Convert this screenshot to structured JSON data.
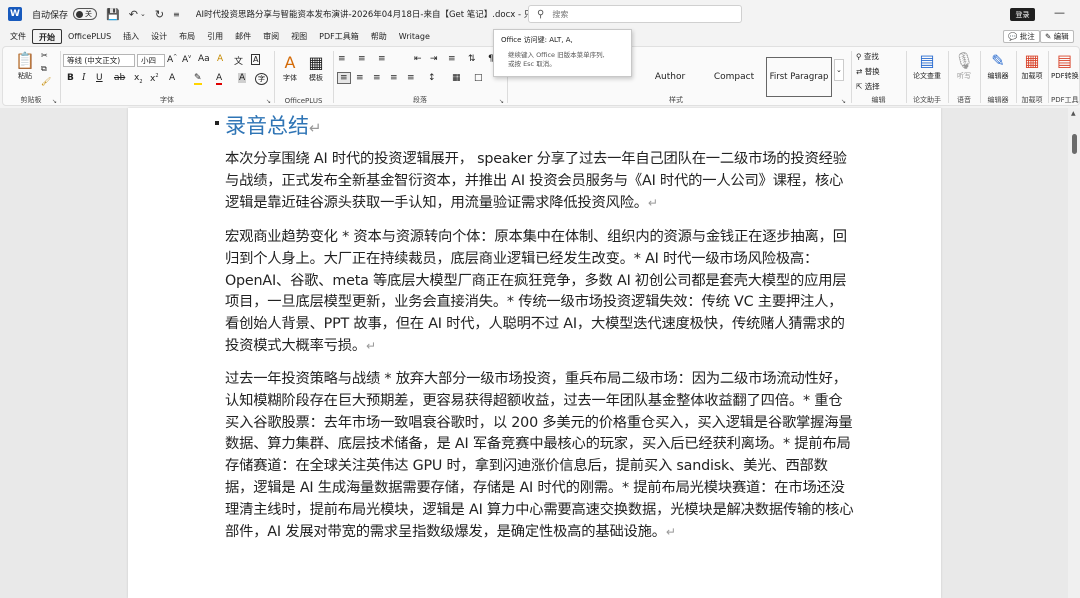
{
  "titlebar": {
    "app_icon": "W",
    "autosave_label": "自动保存",
    "autosave_state": "关",
    "doc_title": "AI时代投资思路分享与智能资本发布演讲-2026年04月18日-来自【Get 笔记】.docx - 只读 - 兼容性...",
    "search_placeholder": "搜索",
    "login_label": "登录",
    "minimize_glyph": "—"
  },
  "tabs": [
    "文件",
    "开始",
    "OfficePLUS",
    "插入",
    "设计",
    "布局",
    "引用",
    "邮件",
    "审阅",
    "视图",
    "PDF工具箱",
    "帮助",
    "Writage"
  ],
  "active_tab": "开始",
  "header_buttons": {
    "comment": "批注",
    "edit": "编辑"
  },
  "tooltip": {
    "title": "Office 访问键: ALT, A,",
    "line1": "继续键入 Office 旧版本菜单序列,",
    "line2": "或按 Esc 取消。"
  },
  "ribbon": {
    "clipboard": {
      "paste": "粘贴",
      "label": "剪贴板"
    },
    "font": {
      "font_name": "等线 (中文正文)",
      "font_size": "小四",
      "label": "字体"
    },
    "officeplus": {
      "btn1": "字体",
      "btn2": "模板",
      "label": "OfficePLUS"
    },
    "paragraph": {
      "label": "段落"
    },
    "styles": {
      "items": [
        "Author",
        "Compact",
        "First Paragrap"
      ],
      "label": "样式"
    },
    "editing": {
      "find": "查找",
      "replace": "替换",
      "select": "选择",
      "label": "编辑"
    },
    "assistant": {
      "btn": "论文查重",
      "label": "论文助手"
    },
    "voice": {
      "btn": "听写",
      "label": "语音"
    },
    "editor": {
      "btn": "编辑器",
      "label": "编辑器"
    },
    "addins": {
      "btn": "加载项",
      "label": "加载项"
    },
    "pdf": {
      "btn": "PDF转换",
      "label": "PDF工具"
    }
  },
  "document": {
    "heading": "录音总结",
    "paragraphs": [
      "本次分享围绕 AI 时代的投资逻辑展开， speaker 分享了过去一年自己团队在一二级市场的投资经验与战绩，正式发布全新基金智衍资本，并推出 AI 投资会员服务与《AI 时代的一人公司》课程，核心逻辑是靠近硅谷源头获取一手认知，用流量验证需求降低投资风险。",
      "宏观商业趋势变化 * 资本与资源转向个体：原本集中在体制、组织内的资源与金钱正在逐步抽离，回归到个人身上。大厂正在持续裁员，底层商业逻辑已经发生改变。* AI 时代一级市场风险极高：OpenAI、谷歌、meta 等底层大模型厂商正在疯狂竞争，多数 AI 初创公司都是套壳大模型的应用层项目，一旦底层模型更新，业务会直接消失。* 传统一级市场投资逻辑失效：传统 VC 主要押注人，看创始人背景、PPT 故事，但在 AI 时代，人聪明不过 AI，大模型迭代速度极快，传统赌人猜需求的投资模式大概率亏损。",
      "过去一年投资策略与战绩 * 放弃大部分一级市场投资，重兵布局二级市场：因为二级市场流动性好，认知模糊阶段存在巨大预期差，更容易获得超额收益，过去一年团队基金整体收益翻了四倍。* 重仓买入谷歌股票：去年市场一致唱衰谷歌时，以 200 多美元的价格重仓买入，买入逻辑是谷歌掌握海量数据、算力集群、底层技术储备，是 AI 军备竞赛中最核心的玩家，买入后已经获利离场。* 提前布局存储赛道：在全球关注英伟达 GPU 时，拿到闪迪涨价信息后，提前买入 sandisk、美光、西部数据，逻辑是 AI 生成海量数据需要存储，存储是 AI 时代的刚需。* 提前布局光模块赛道：在市场还没理清主线时，提前布局光模块，逻辑是 AI 算力中心需要高速交换数据，光模块是解决数据传输的核心部件，AI 发展对带宽的需求呈指数级爆发，是确定性极高的基础设施。"
    ],
    "para_mark": "↵"
  }
}
